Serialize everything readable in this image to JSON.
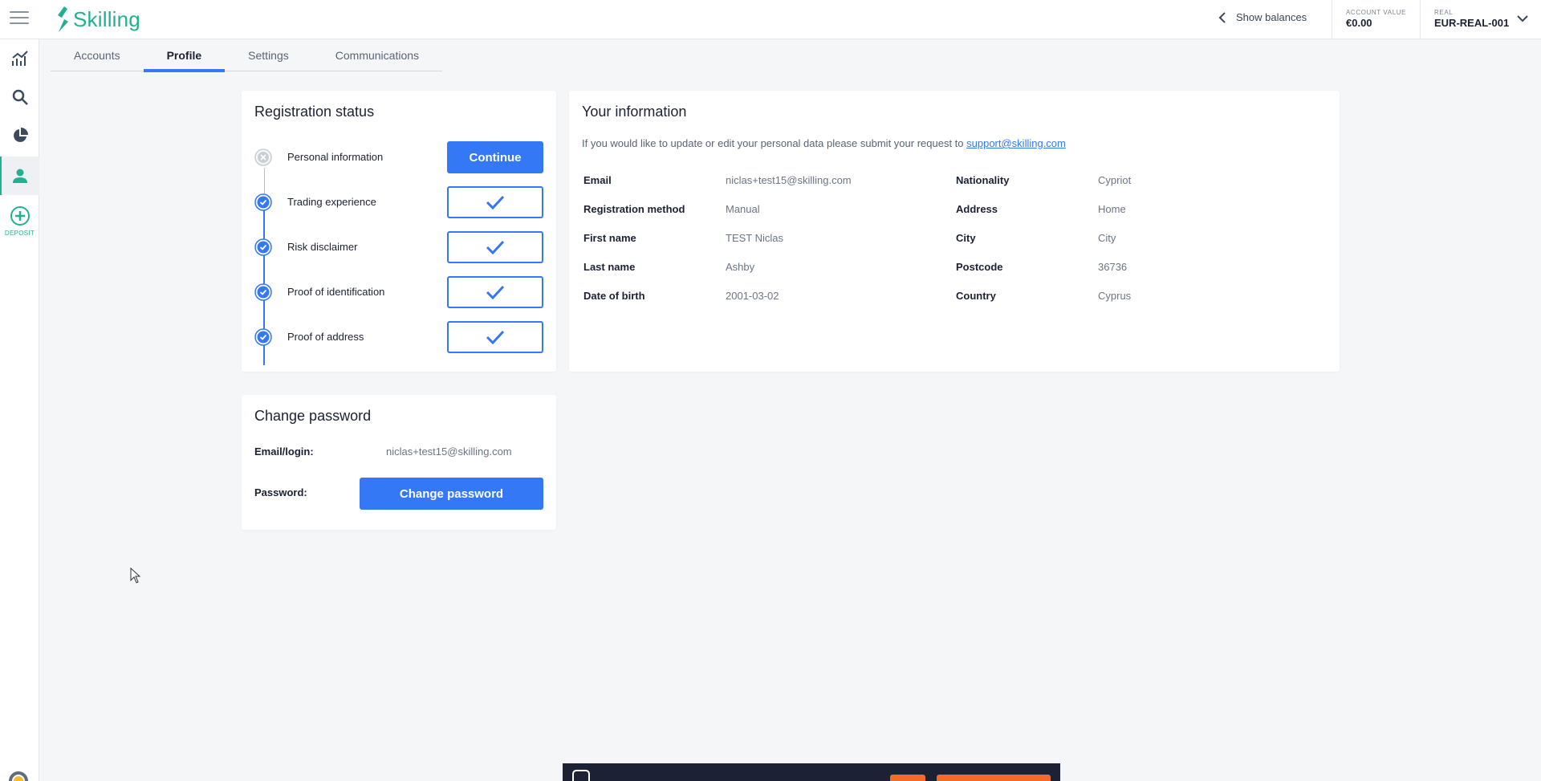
{
  "app": {
    "logo_text": "Skilling",
    "brand_color": "#22b190",
    "accent_color": "#3478f6"
  },
  "header": {
    "show_balances_label": "Show balances",
    "account_value_label": "ACCOUNT VALUE",
    "account_value": "€0.00",
    "account_type_label": "REAL",
    "account_id": "EUR-REAL-001"
  },
  "sidebar": {
    "items": [
      {
        "icon": "chart-line-icon"
      },
      {
        "icon": "search-icon"
      },
      {
        "icon": "pie-chart-icon"
      },
      {
        "icon": "user-icon",
        "active": true
      }
    ],
    "deposit_label": "DEPOSIT"
  },
  "tabs": [
    {
      "label": "Accounts"
    },
    {
      "label": "Profile",
      "active": true
    },
    {
      "label": "Settings"
    },
    {
      "label": "Communications"
    }
  ],
  "registration": {
    "title": "Registration status",
    "continue_label": "Continue",
    "steps": [
      {
        "label": "Personal information",
        "status": "incomplete"
      },
      {
        "label": "Trading experience",
        "status": "complete"
      },
      {
        "label": "Risk disclaimer",
        "status": "complete"
      },
      {
        "label": "Proof of identification",
        "status": "complete"
      },
      {
        "label": "Proof of address",
        "status": "complete"
      }
    ]
  },
  "your_info": {
    "title": "Your information",
    "note_text": "If you would like to update or edit your personal data please submit your request to ",
    "note_link": "support@skilling.com",
    "left": [
      {
        "label": "Email",
        "value": "niclas+test15@skilling.com"
      },
      {
        "label": "Registration method",
        "value": "Manual"
      },
      {
        "label": "First name",
        "value": "TEST Niclas"
      },
      {
        "label": "Last name",
        "value": "Ashby"
      },
      {
        "label": "Date of birth",
        "value": "2001-03-02"
      }
    ],
    "right": [
      {
        "label": "Nationality",
        "value": "Cypriot"
      },
      {
        "label": "Address",
        "value": "Home"
      },
      {
        "label": "City",
        "value": "City"
      },
      {
        "label": "Postcode",
        "value": "36736"
      },
      {
        "label": "Country",
        "value": "Cyprus"
      }
    ]
  },
  "change_password": {
    "title": "Change password",
    "email_label": "Email/login:",
    "email_value": "niclas+test15@skilling.com",
    "password_label": "Password:",
    "button_label": "Change password"
  }
}
